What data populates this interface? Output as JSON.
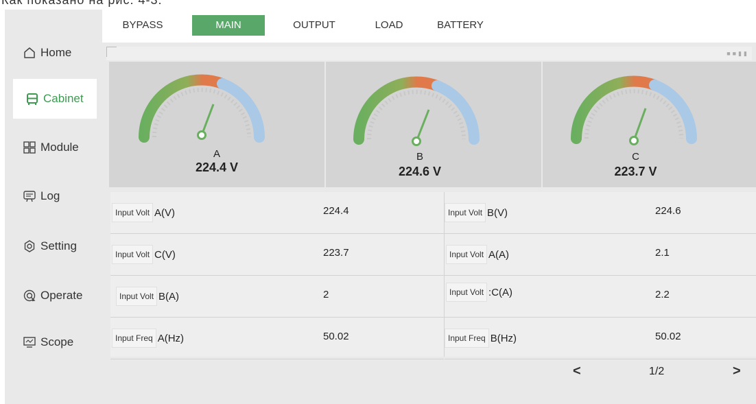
{
  "caption": "Как показано на рис. 4-3.",
  "sidebar": {
    "items": [
      {
        "label": "Home",
        "icon": "home-icon"
      },
      {
        "label": "Cabinet",
        "icon": "cabinet-icon"
      },
      {
        "label": "Module",
        "icon": "module-icon"
      },
      {
        "label": "Log",
        "icon": "log-icon"
      },
      {
        "label": "Setting",
        "icon": "gear-icon"
      },
      {
        "label": "Operate",
        "icon": "operate-icon"
      },
      {
        "label": "Scope",
        "icon": "scope-icon"
      }
    ],
    "active": "Cabinet"
  },
  "tabs": {
    "items": [
      "BYPASS",
      "MAIN",
      "OUTPUT",
      "LOAD",
      "BATTERY"
    ],
    "active": "MAIN"
  },
  "gauges": [
    {
      "phase": "A",
      "value": "224.4 V"
    },
    {
      "phase": "B",
      "value": "224.6 V"
    },
    {
      "phase": "C",
      "value": "223.7 V"
    }
  ],
  "table": {
    "rows": [
      [
        {
          "tag": "Input Volt",
          "label": "A(V)",
          "value": "224.4"
        },
        {
          "tag": "Input Volt",
          "label": "B(V)",
          "value": "224.6"
        }
      ],
      [
        {
          "tag": "Input Volt",
          "label": "C(V)",
          "value": "223.7"
        },
        {
          "tag": "Input Volt",
          "label": "A(A)",
          "value": "2.1"
        }
      ],
      [
        {
          "tag": "Input Volt",
          "label": "B(A)",
          "value": "2"
        },
        {
          "tag": "Input Volt",
          "label": ":C(A)",
          "value": "2.2"
        }
      ],
      [
        {
          "tag": "Input Freq",
          "label": "A(Hz)",
          "value": "50.02"
        },
        {
          "tag": "Input Freq",
          "label": "B(Hz)",
          "value": "50.02"
        }
      ]
    ]
  },
  "pager": {
    "page": "1/2",
    "prev_icon": "chevron-left-icon",
    "next_icon": "chevron-right-icon"
  },
  "colors": {
    "accent": "#5aa76a",
    "gauge_green": "#6aaf5f",
    "gauge_orange": "#e07a4a",
    "gauge_blue": "#a9c9e6"
  }
}
